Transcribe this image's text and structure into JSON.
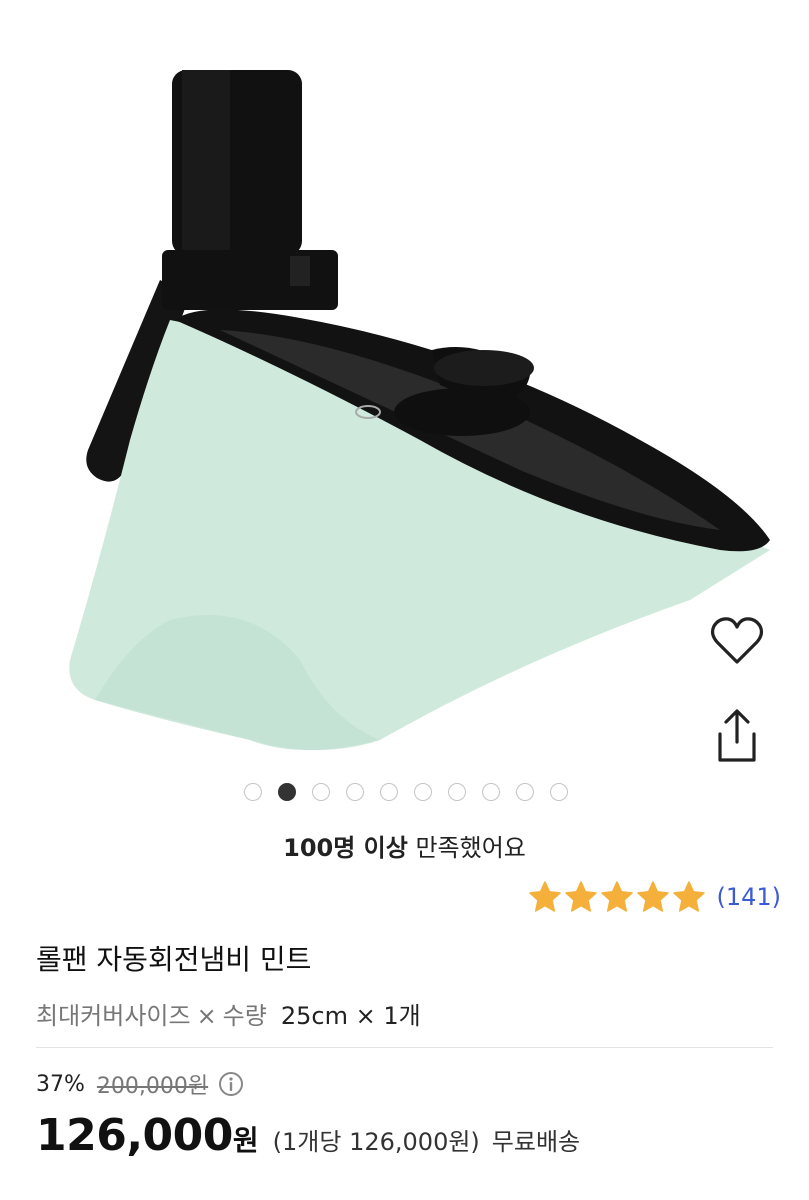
{
  "satisfaction": {
    "bold": "100명 이상",
    "rest": "만족했어요"
  },
  "rating": {
    "stars": 5,
    "count": "(141)"
  },
  "product": {
    "title": "롤팬 자동회전냄비 민트",
    "option_name": "최대커버사이즈",
    "option_times": "×",
    "option_qty_label": "수량",
    "option_value": "25cm × 1개"
  },
  "price": {
    "discount": "37%",
    "original": "200,000원",
    "sale_amount": "126,000",
    "sale_unit": "원",
    "per_unit": "(1개당 126,000원)",
    "shipping": "무료배송"
  },
  "carousel": {
    "total": 10,
    "active_index": 1
  },
  "icons": {
    "wishlist": "heart-icon",
    "share": "share-icon",
    "info": "info-icon",
    "star": "star-icon"
  },
  "colors": {
    "star": "#f4b03a",
    "link": "#3b5bd6",
    "product_body": "#cfe9dc",
    "lid": "#111111"
  }
}
